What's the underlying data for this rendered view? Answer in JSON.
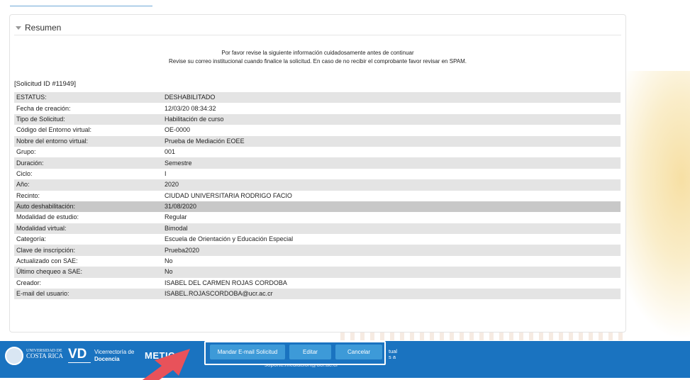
{
  "panel": {
    "title": "Resumen"
  },
  "notice": {
    "line1": "Por favor revise la siguiente información cuidadosamente antes de continuar",
    "line2": "Revise su correo institucional cuando finalice la solicitud. En caso de no recibir el comprobante favor revisar en SPAM."
  },
  "solicitud_id": "[Solicitud ID #11949]",
  "details": [
    {
      "label": "ESTATUS:",
      "value": "DESHABILITADO"
    },
    {
      "label": "Fecha de creación:",
      "value": "12/03/20 08:34:32"
    },
    {
      "label": "Tipo de Solicitud:",
      "value": "Habilitación de curso"
    },
    {
      "label": "Código del Entorno virtual:",
      "value": "OE-0000"
    },
    {
      "label": "Nobre del entorno virtual:",
      "value": "Prueba de Mediación EOEE"
    },
    {
      "label": "Grupo:",
      "value": "001"
    },
    {
      "label": "Duración:",
      "value": "Semestre"
    },
    {
      "label": "Ciclo:",
      "value": "I"
    },
    {
      "label": "Año:",
      "value": "2020"
    },
    {
      "label": "Recinto:",
      "value": "CIUDAD UNIVERSITARIA RODRIGO FACIO"
    },
    {
      "label": "Auto deshabilitación:",
      "value": "31/08/2020"
    },
    {
      "label": "Modalidad de estudio:",
      "value": "Regular"
    },
    {
      "label": "Modalidad virtual:",
      "value": "Bimodal"
    },
    {
      "label": "Categoría:",
      "value": "Escuela de Orientación y Educación Especial"
    },
    {
      "label": "Clave de inscripción:",
      "value": "Prueba2020"
    },
    {
      "label": "Actualizado con SAE:",
      "value": "No"
    },
    {
      "label": "Último chequeo a SAE:",
      "value": "No"
    },
    {
      "label": "Creador:",
      "value": "ISABEL DEL CARMEN ROJAS CORDOBA"
    },
    {
      "label": "E-mail del usuario:",
      "value": "ISABEL.ROJASCORDOBA@ucr.ac.cr"
    }
  ],
  "actions": {
    "mail": "Mandar E-mail Solicitud",
    "edit": "Editar",
    "cancel": "Cancelar"
  },
  "footer": {
    "ucr_small": "UNIVERSIDAD DE",
    "ucr_big": "COSTA RICA",
    "vd": "VD",
    "vic_line1": "Vicerrectoría de",
    "vic_line2": "Docencia",
    "metics": "METIC",
    "right_line1": "tual",
    "right_line2": "s a",
    "email": "soporte.mediacion@ucr.ac.cr"
  },
  "colors": {
    "footer_bg": "#1a73c0",
    "button_bg": "#3d9ad8",
    "arrow": "#e8525a"
  }
}
